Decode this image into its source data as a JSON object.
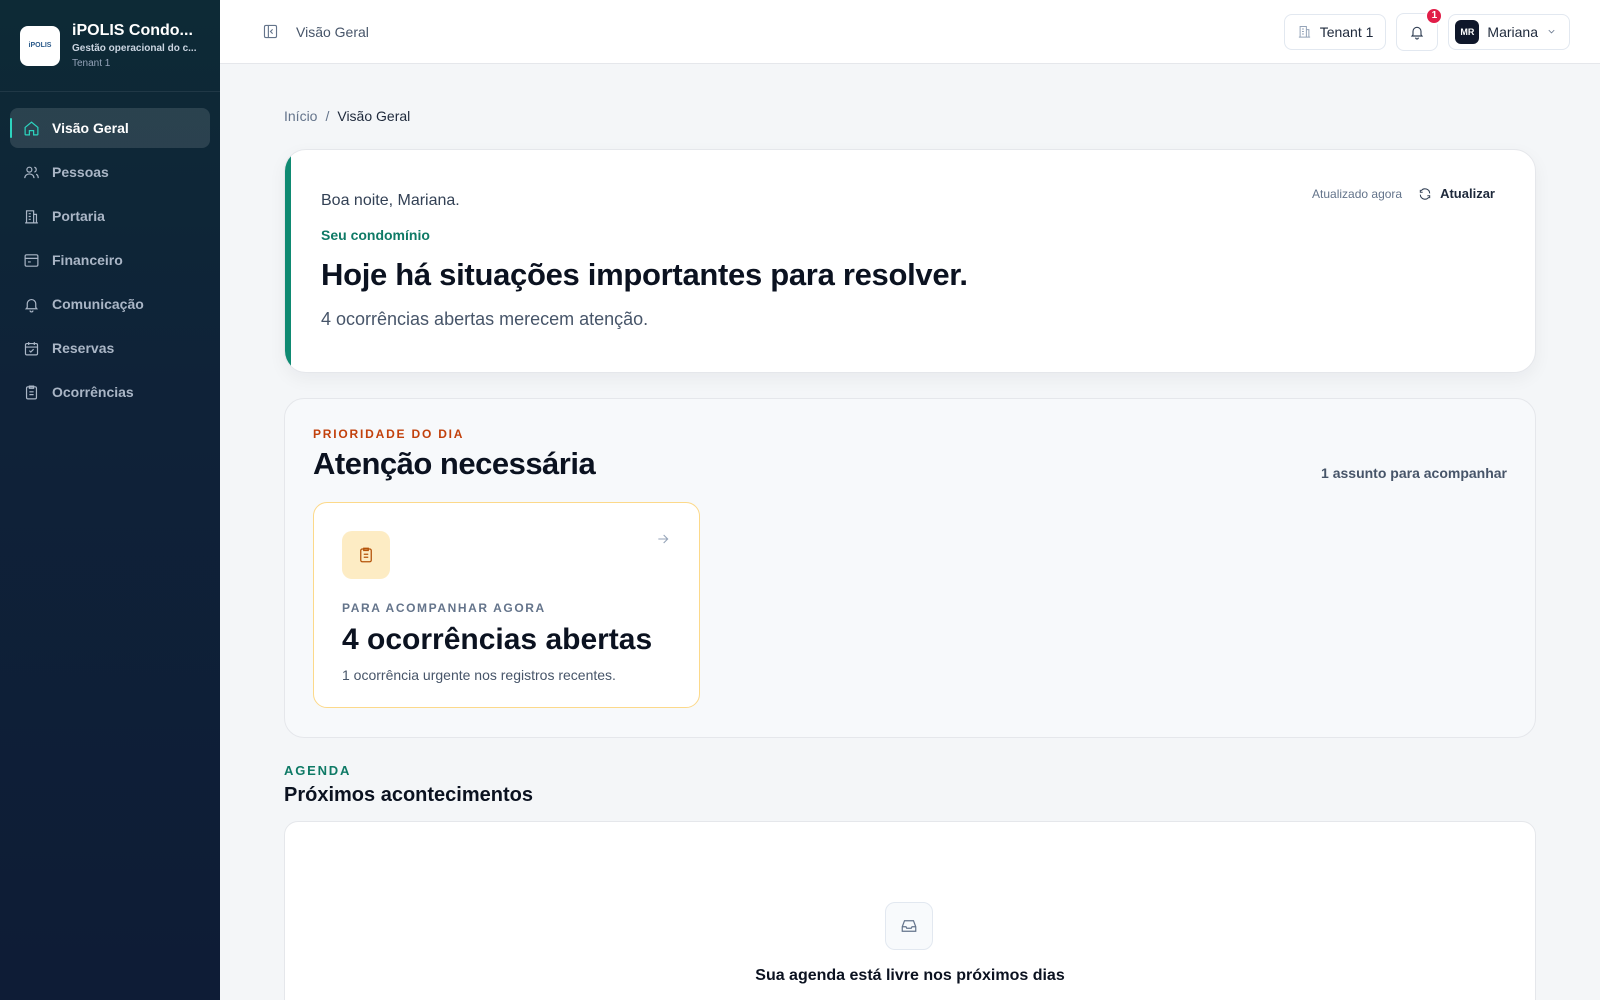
{
  "brand": {
    "logo_text": "iPOLIS",
    "name": "iPOLIS Condo...",
    "subtitle": "Gestão operacional do c...",
    "tenant": "Tenant 1"
  },
  "sidebar": {
    "items": [
      {
        "label": "Visão Geral",
        "icon": "home-icon",
        "active": true
      },
      {
        "label": "Pessoas",
        "icon": "users-icon"
      },
      {
        "label": "Portaria",
        "icon": "building-icon"
      },
      {
        "label": "Financeiro",
        "icon": "wallet-icon"
      },
      {
        "label": "Comunicação",
        "icon": "bell-icon"
      },
      {
        "label": "Reservas",
        "icon": "calendar-check-icon"
      },
      {
        "label": "Ocorrências",
        "icon": "clipboard-icon"
      }
    ]
  },
  "topbar": {
    "title": "Visão Geral",
    "tenant_label": "Tenant 1",
    "notification_count": "1",
    "user_initials": "MR",
    "user_name": "Mariana"
  },
  "breadcrumb": {
    "home": "Início",
    "separator": "/",
    "current": "Visão Geral"
  },
  "hero": {
    "greeting": "Boa noite, Mariana.",
    "kicker": "Seu condomínio",
    "title": "Hoje há situações importantes para resolver.",
    "description": "4 ocorrências abertas merecem atenção.",
    "updated": "Atualizado agora",
    "refresh_label": "Atualizar"
  },
  "priority": {
    "kicker": "PRIORIDADE DO DIA",
    "title": "Atenção necessária",
    "count_label": "1 assunto para acompanhar",
    "card": {
      "kicker": "PARA ACOMPANHAR AGORA",
      "title": "4 ocorrências abertas",
      "description": "1 ocorrência urgente nos registros recentes."
    }
  },
  "agenda": {
    "kicker": "AGENDA",
    "title": "Próximos acontecimentos",
    "empty_text": "Sua agenda está livre nos próximos dias"
  },
  "colors": {
    "accent": "#0f7a66",
    "sidebar_bg": "#0f2238",
    "warning_border": "#fcd98a",
    "badge": "#e11d48"
  }
}
